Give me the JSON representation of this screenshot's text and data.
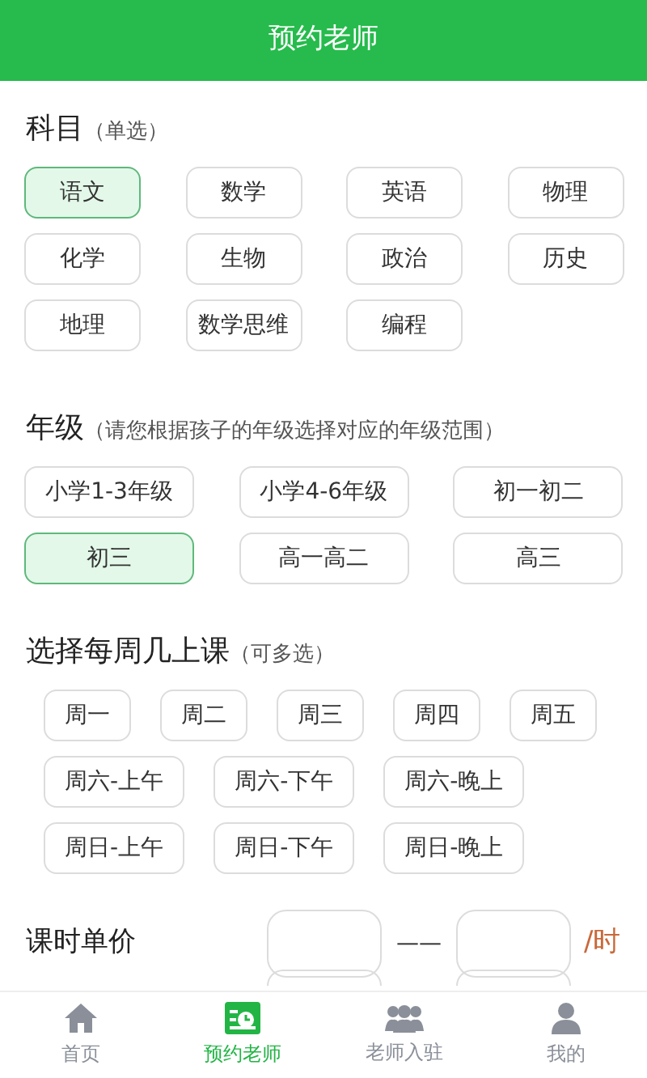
{
  "header": {
    "title": "预约老师"
  },
  "subject": {
    "title": "科目",
    "hint": "（单选）",
    "options": [
      {
        "label": "语文",
        "selected": true
      },
      {
        "label": "数学",
        "selected": false
      },
      {
        "label": "英语",
        "selected": false
      },
      {
        "label": "物理",
        "selected": false
      },
      {
        "label": "化学",
        "selected": false
      },
      {
        "label": "生物",
        "selected": false
      },
      {
        "label": "政治",
        "selected": false
      },
      {
        "label": "历史",
        "selected": false
      },
      {
        "label": "地理",
        "selected": false
      },
      {
        "label": "数学思维",
        "selected": false
      },
      {
        "label": "编程",
        "selected": false
      }
    ]
  },
  "grade": {
    "title": "年级",
    "hint": "（请您根据孩子的年级选择对应的年级范围）",
    "options": [
      {
        "label": "小学1-3年级",
        "selected": false
      },
      {
        "label": "小学4-6年级",
        "selected": false
      },
      {
        "label": "初一初二",
        "selected": false
      },
      {
        "label": "初三",
        "selected": true
      },
      {
        "label": "高一高二",
        "selected": false
      },
      {
        "label": "高三",
        "selected": false
      }
    ]
  },
  "weekdays": {
    "title": "选择每周几上课",
    "hint": "（可多选）",
    "options": [
      {
        "label": "周一",
        "selected": false
      },
      {
        "label": "周二",
        "selected": false
      },
      {
        "label": "周三",
        "selected": false
      },
      {
        "label": "周四",
        "selected": false
      },
      {
        "label": "周五",
        "selected": false
      },
      {
        "label": "周六-上午",
        "selected": false
      },
      {
        "label": "周六-下午",
        "selected": false
      },
      {
        "label": "周六-晚上",
        "selected": false
      },
      {
        "label": "周日-上午",
        "selected": false
      },
      {
        "label": "周日-下午",
        "selected": false
      },
      {
        "label": "周日-晚上",
        "selected": false
      }
    ]
  },
  "ranges": [
    {
      "label": "课时单价",
      "separator": "——",
      "unit": "/时"
    }
  ],
  "partial_row": {
    "kind": "range"
  },
  "tabbar": [
    {
      "label": "首页",
      "kind": "home",
      "selected": false
    },
    {
      "label": "预约老师",
      "kind": "book",
      "selected": true
    },
    {
      "label": "老师入驻",
      "kind": "group",
      "selected": false
    },
    {
      "label": "我的",
      "kind": "user",
      "selected": false
    }
  ]
}
